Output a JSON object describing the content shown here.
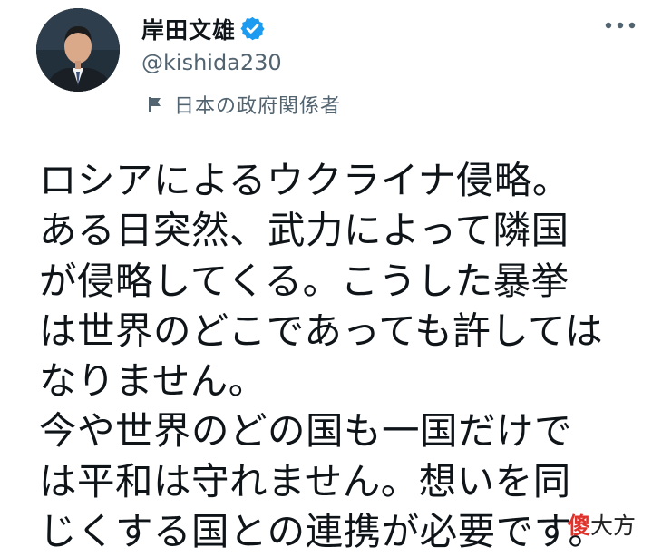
{
  "author": {
    "name": "岸田文雄",
    "handle": "@kishida230",
    "label": "日本の政府関係者",
    "verified": true
  },
  "icons": {
    "verified": "verified-badge-icon",
    "label": "flag-icon",
    "more": "more-options-icon"
  },
  "colors": {
    "verified_blue": "#1d9bf0",
    "secondary_text": "#536471",
    "primary_text": "#0f1419",
    "watermark_red": "#e0322b"
  },
  "tweet": {
    "lines": [
      "ロシアによるウクライナ侵略。",
      "ある日突然、武力によって隣国",
      "が侵略してくる。こうした暴挙",
      "は世界のどこであっても許しては",
      "なりません。",
      "今や世界のどの国も一国だけで",
      "は平和は守れません。想いを同",
      "じくする国との連携が必要です。"
    ]
  },
  "watermark": {
    "char1": "傻",
    "rest": "大方"
  }
}
